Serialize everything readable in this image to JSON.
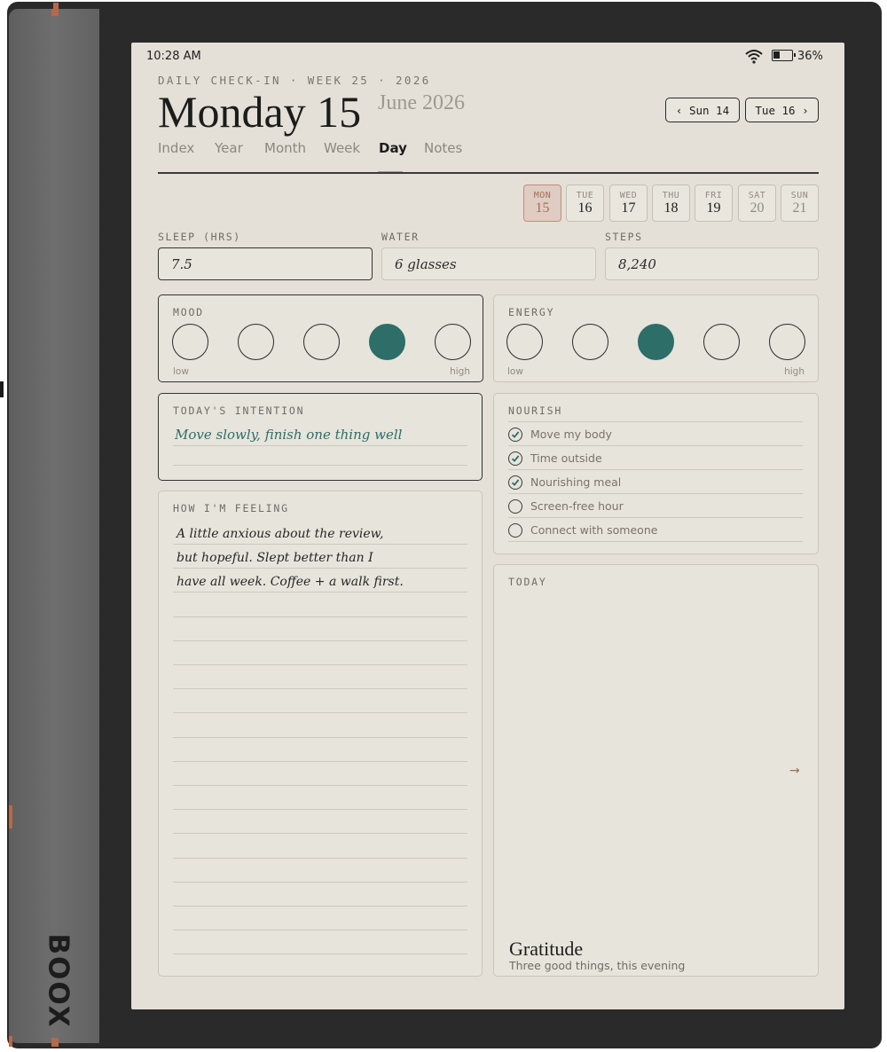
{
  "device": {
    "brand": "BOOX"
  },
  "status": {
    "time": "10:28 AM",
    "battery": "36%",
    "battery_level": 0.36
  },
  "header": {
    "eyebrow": "DAILY CHECK-IN · WEEK 25 · 2026",
    "title": "Monday 15",
    "subtitle": "June 2026",
    "prev_label": "‹ Sun 14",
    "next_label": "Tue 16 ›"
  },
  "tabs": [
    {
      "label": "Index"
    },
    {
      "label": "Year"
    },
    {
      "label": "Month"
    },
    {
      "label": "Week"
    },
    {
      "label": "Day",
      "active": true
    },
    {
      "label": "Notes"
    }
  ],
  "week": [
    {
      "name": "MON",
      "date": "15",
      "active": true
    },
    {
      "name": "TUE",
      "date": "16"
    },
    {
      "name": "WED",
      "date": "17"
    },
    {
      "name": "THU",
      "date": "18"
    },
    {
      "name": "FRI",
      "date": "19"
    },
    {
      "name": "SAT",
      "date": "20",
      "weekend": true
    },
    {
      "name": "SUN",
      "date": "21",
      "weekend": true
    }
  ],
  "metrics": {
    "sleep": {
      "label": "SLEEP (HRS)",
      "value": "7.5"
    },
    "water": {
      "label": "WATER",
      "value": "6 glasses"
    },
    "steps": {
      "label": "STEPS",
      "value": "8,240"
    }
  },
  "mood": {
    "label": "MOOD",
    "low": "low",
    "high": "high",
    "selected": 4,
    "max": 5
  },
  "energy": {
    "label": "ENERGY",
    "low": "low",
    "high": "high",
    "selected": 3,
    "max": 5
  },
  "intention": {
    "label": "TODAY'S INTENTION",
    "text": "Move slowly, finish one thing well"
  },
  "feeling": {
    "label": "HOW I'M FEELING",
    "lines": [
      "A little anxious about the review,",
      "but hopeful. Slept better than I",
      "have all week. Coffee + a walk first."
    ]
  },
  "nourish": {
    "label": "NOURISH",
    "items": [
      {
        "label": "Move my body",
        "checked": true
      },
      {
        "label": "Time outside",
        "checked": true
      },
      {
        "label": "Nourishing meal",
        "checked": true
      },
      {
        "label": "Screen-free hour",
        "checked": false
      },
      {
        "label": "Connect with someone",
        "checked": false
      }
    ]
  },
  "today": {
    "label": "TODAY",
    "arrow": "→",
    "footer_title": "Gratitude",
    "footer_sub": "Three good things, this evening"
  },
  "colors": {
    "accent_teal": "#2d6e68",
    "accent_rust": "#a66d59",
    "paper": "#e4e0d7"
  }
}
